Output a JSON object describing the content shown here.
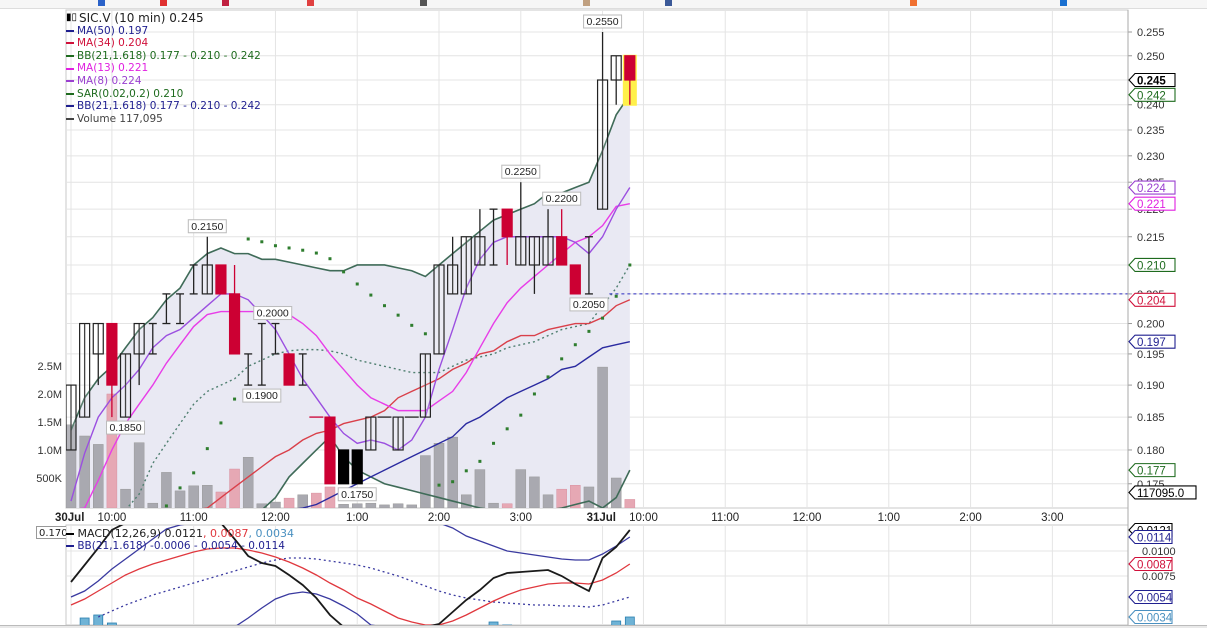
{
  "legend": {
    "title": "SIC.V (10 min) 0.245",
    "items": [
      {
        "label": "MA(50) 0.197",
        "color": "#1f1f8f"
      },
      {
        "label": "MA(34) 0.204",
        "color": "#d0103a"
      },
      {
        "label": "BB(21,1.618) 0.177 - 0.210 - 0.242",
        "color": "#1e6b1e"
      },
      {
        "label": "MA(13) 0.221",
        "color": "#e020e0"
      },
      {
        "label": "MA(8) 0.224",
        "color": "#9a40d0"
      },
      {
        "label": "SAR(0.02,0.2) 0.210",
        "color": "#1e6b1e"
      },
      {
        "label": "BB(21,1.618) 0.177 - 0.210 - 0.242",
        "color": "#1f1f8f"
      },
      {
        "label": "Volume 117,095",
        "color": "#444444"
      }
    ]
  },
  "macd_legend": {
    "name": "MACD(12,26,9)",
    "macd": "0.0121",
    "signal": ", 0.0087",
    "hist": ", 0.0034",
    "bb": "BB(21,1.618) -0.0006 - 0.0054 - 0.0114"
  },
  "cut_label": "0.170",
  "chart_data": {
    "type": "candlestick",
    "title": "SIC.V (10 min)",
    "y_scale": "log",
    "ylim": [
      0.1715,
      0.258
    ],
    "grid": true,
    "y_ticks": [
      "0.255",
      "0.250",
      "0.245",
      "0.240",
      "0.235",
      "0.230",
      "0.225",
      "0.220",
      "0.215",
      "0.210",
      "0.205",
      "0.200",
      "0.195",
      "0.190",
      "0.185",
      "0.180",
      "0.175"
    ],
    "volume_ticks": [
      {
        "label": "2.5M",
        "value": 2.5
      },
      {
        "label": "2.0M",
        "value": 2.0
      },
      {
        "label": "1.5M",
        "value": 1.5
      },
      {
        "label": "1.0M",
        "value": 1.0
      },
      {
        "label": "500K",
        "value": 0.5
      }
    ],
    "x_ticks": [
      {
        "label": "30Jul",
        "bar": 0,
        "bold": true
      },
      {
        "label": "10:00",
        "bar": 3
      },
      {
        "label": "11:00",
        "bar": 9
      },
      {
        "label": "12:00",
        "bar": 15
      },
      {
        "label": "1:00",
        "bar": 21
      },
      {
        "label": "2:00",
        "bar": 27
      },
      {
        "label": "3:00",
        "bar": 33
      },
      {
        "label": "31Jul",
        "bar": 39,
        "bold": true
      },
      {
        "label": "10:00",
        "bar": 42
      },
      {
        "label": "11:00",
        "bar": 48
      },
      {
        "label": "12:00",
        "bar": 54
      },
      {
        "label": "1:00",
        "bar": 60
      },
      {
        "label": "2:00",
        "bar": 66
      },
      {
        "label": "3:00",
        "bar": 72
      }
    ],
    "candles": [
      [
        0.18,
        0.19,
        0.18,
        0.19,
        "up"
      ],
      [
        0.185,
        0.2,
        0.185,
        0.2,
        "up"
      ],
      [
        0.195,
        0.2,
        0.19,
        0.2,
        "up"
      ],
      [
        0.2,
        0.2,
        0.185,
        0.19,
        "down"
      ],
      [
        0.185,
        0.195,
        0.185,
        0.195,
        "up"
      ],
      [
        0.195,
        0.2,
        0.19,
        0.2,
        "up"
      ],
      [
        0.2,
        0.2,
        0.195,
        0.2,
        "up"
      ],
      [
        0.205,
        0.205,
        0.2,
        0.205,
        "up"
      ],
      [
        0.205,
        0.205,
        0.2,
        0.205,
        "up"
      ],
      [
        0.21,
        0.21,
        0.205,
        0.21,
        "up"
      ],
      [
        0.205,
        0.215,
        0.205,
        0.21,
        "up"
      ],
      [
        0.21,
        0.21,
        0.205,
        0.205,
        "down"
      ],
      [
        0.205,
        0.21,
        0.195,
        0.195,
        "down"
      ],
      [
        0.195,
        0.195,
        0.19,
        0.195,
        "up"
      ],
      [
        0.2,
        0.2,
        0.19,
        0.2,
        "up"
      ],
      [
        0.2,
        0.2,
        0.195,
        0.2,
        "up"
      ],
      [
        0.195,
        0.195,
        0.19,
        0.19,
        "down"
      ],
      [
        0.195,
        0.195,
        0.19,
        0.195,
        "up"
      ],
      [
        0.185,
        0.185,
        0.185,
        0.185,
        "down"
      ],
      [
        0.185,
        0.185,
        0.175,
        0.175,
        "down"
      ],
      [
        0.18,
        0.18,
        0.175,
        0.175,
        "black"
      ],
      [
        0.18,
        0.18,
        0.175,
        0.175,
        "black"
      ],
      [
        0.18,
        0.185,
        0.18,
        0.185,
        "up"
      ],
      [
        0.185,
        0.185,
        0.185,
        0.185,
        "up"
      ],
      [
        0.18,
        0.185,
        0.18,
        0.185,
        "up"
      ],
      [
        0.185,
        0.185,
        0.185,
        0.185,
        "up"
      ],
      [
        0.185,
        0.195,
        0.185,
        0.195,
        "up"
      ],
      [
        0.195,
        0.21,
        0.195,
        0.21,
        "up"
      ],
      [
        0.205,
        0.215,
        0.205,
        0.21,
        "up"
      ],
      [
        0.205,
        0.215,
        0.205,
        0.215,
        "up"
      ],
      [
        0.21,
        0.22,
        0.21,
        0.215,
        "up"
      ],
      [
        0.22,
        0.22,
        0.21,
        0.22,
        "up"
      ],
      [
        0.22,
        0.22,
        0.21,
        0.215,
        "down"
      ],
      [
        0.21,
        0.225,
        0.21,
        0.215,
        "up"
      ],
      [
        0.21,
        0.215,
        0.205,
        0.215,
        "up"
      ],
      [
        0.21,
        0.22,
        0.21,
        0.215,
        "up"
      ],
      [
        0.215,
        0.22,
        0.21,
        0.21,
        "down"
      ],
      [
        0.21,
        0.21,
        0.205,
        0.205,
        "down"
      ],
      [
        0.205,
        0.215,
        0.205,
        0.205,
        "up"
      ],
      [
        0.22,
        0.255,
        0.22,
        0.245,
        "up"
      ],
      [
        0.245,
        0.25,
        0.24,
        0.25,
        "up"
      ],
      [
        0.25,
        0.25,
        0.24,
        0.245,
        "down"
      ]
    ],
    "highlight_last": true,
    "volume_millions": [
      1.45,
      1.25,
      1.1,
      2.0,
      0.3,
      1.13,
      0.05,
      0.6,
      0.27,
      0.36,
      0.37,
      0.25,
      0.66,
      0.87,
      0.04,
      0.07,
      0.14,
      0.2,
      0.23,
      0.34,
      0.03,
      0.04,
      0.05,
      0.02,
      0.04,
      0.02,
      0.9,
      1.12,
      1.23,
      0.2,
      0.65,
      0.05,
      0.04,
      0.65,
      0.52,
      0.2,
      0.3,
      0.37,
      0.34,
      2.48,
      0.5,
      0.117
    ],
    "series": {
      "bb_upper": [
        0.183,
        0.188,
        0.191,
        0.193,
        0.196,
        0.199,
        0.201,
        0.204,
        0.206,
        0.21,
        0.212,
        0.213,
        0.212,
        0.212,
        0.211,
        0.211,
        0.2105,
        0.21,
        0.2095,
        0.209,
        0.209,
        0.21,
        0.21,
        0.21,
        0.2095,
        0.209,
        0.208,
        0.21,
        0.212,
        0.214,
        0.216,
        0.218,
        0.219,
        0.22,
        0.221,
        0.223,
        0.223,
        0.224,
        0.225,
        0.231,
        0.238,
        0.242
      ],
      "bb_lower": [
        0.15,
        0.15,
        0.15,
        0.15,
        0.15,
        0.148,
        0.155,
        0.158,
        0.162,
        0.164,
        0.166,
        0.167,
        0.168,
        0.169,
        0.171,
        0.173,
        0.176,
        0.178,
        0.18,
        0.182,
        0.179,
        0.177,
        0.176,
        0.175,
        0.1745,
        0.174,
        0.1735,
        0.173,
        0.1725,
        0.172,
        0.1715,
        0.171,
        0.171,
        0.171,
        0.171,
        0.171,
        0.1715,
        0.172,
        0.1725,
        0.1715,
        0.173,
        0.177
      ],
      "bb_mid": [
        null,
        null,
        null,
        null,
        0.17,
        0.1735,
        0.178,
        0.181,
        0.184,
        0.187,
        0.189,
        0.19,
        0.191,
        0.193,
        0.194,
        0.195,
        0.1955,
        0.1957,
        0.1957,
        0.1955,
        0.195,
        0.194,
        0.1935,
        0.193,
        0.1925,
        0.192,
        0.192,
        0.192,
        0.193,
        0.194,
        0.1945,
        0.195,
        0.196,
        0.1965,
        0.197,
        0.198,
        0.199,
        0.1995,
        0.2,
        0.203,
        0.206,
        0.21
      ],
      "ma8": [
        0.1725,
        0.1795,
        0.185,
        0.188,
        0.19,
        0.1925,
        0.196,
        0.198,
        0.199,
        0.201,
        0.203,
        0.205,
        0.205,
        0.204,
        0.2015,
        0.199,
        0.195,
        0.191,
        0.188,
        0.185,
        0.1825,
        0.181,
        0.1815,
        0.181,
        0.18,
        0.1815,
        0.185,
        0.1925,
        0.199,
        0.206,
        0.211,
        0.214,
        0.215,
        0.215,
        0.215,
        0.215,
        0.215,
        0.214,
        0.212,
        0.215,
        0.22,
        0.224
      ],
      "ma13": [
        0.168,
        0.1715,
        0.1755,
        0.18,
        0.184,
        0.187,
        0.19,
        0.1935,
        0.1965,
        0.1995,
        0.2015,
        0.202,
        0.202,
        0.202,
        0.202,
        0.202,
        0.2015,
        0.2,
        0.198,
        0.195,
        0.1925,
        0.19,
        0.188,
        0.187,
        0.186,
        0.186,
        0.186,
        0.1875,
        0.189,
        0.192,
        0.196,
        0.2,
        0.2035,
        0.206,
        0.208,
        0.21,
        0.212,
        0.214,
        0.215,
        0.217,
        0.2205,
        0.221
      ],
      "ma34": [
        null,
        null,
        null,
        null,
        null,
        null,
        null,
        null,
        null,
        0.17,
        0.1715,
        0.173,
        0.1745,
        0.176,
        0.1775,
        0.179,
        0.18,
        0.1815,
        0.1825,
        0.183,
        0.184,
        0.1845,
        0.185,
        0.186,
        0.188,
        0.189,
        0.19,
        0.191,
        0.1925,
        0.1935,
        0.195,
        0.1955,
        0.197,
        0.198,
        0.198,
        0.199,
        0.1995,
        0.2,
        0.2,
        0.201,
        0.203,
        0.204
      ],
      "ma50": [
        null,
        null,
        null,
        null,
        null,
        null,
        null,
        null,
        null,
        null,
        null,
        null,
        null,
        null,
        null,
        null,
        0.17,
        0.1715,
        0.172,
        0.173,
        0.174,
        0.175,
        0.176,
        0.177,
        0.178,
        0.179,
        0.18,
        0.181,
        0.182,
        0.184,
        0.185,
        0.1865,
        0.188,
        0.189,
        0.19,
        0.191,
        0.1925,
        0.193,
        0.1945,
        0.196,
        0.1965,
        0.197
      ],
      "sar": [
        null,
        null,
        null,
        null,
        null,
        null,
        null,
        0.1718,
        0.1744,
        0.1766,
        0.1802,
        0.1841,
        0.1878,
        0.2146,
        0.2141,
        0.2134,
        0.213,
        0.2126,
        0.2121,
        0.2111,
        0.2088,
        0.2067,
        0.2048,
        0.203,
        0.2014,
        0.1997,
        0.1983,
        0.1748,
        0.1753,
        0.1769,
        0.1783,
        0.181,
        0.1832,
        0.1853,
        0.1886,
        0.1913,
        0.1942,
        0.1965,
        0.1987,
        0.2009,
        0.2046,
        0.21
      ]
    },
    "reference_line": {
      "value": 0.205,
      "from_bar": 39.5
    },
    "annotations": [
      {
        "text": "0.2150",
        "bar": 10,
        "price": 0.215,
        "pos": "above"
      },
      {
        "text": "0.2000",
        "bar": 14.8,
        "price": 0.2,
        "pos": "above"
      },
      {
        "text": "0.1900",
        "bar": 14,
        "price": 0.19,
        "pos": "below"
      },
      {
        "text": "0.1850",
        "bar": 4,
        "price": 0.185,
        "pos": "below"
      },
      {
        "text": "0.1750",
        "bar": 21,
        "price": 0.175,
        "pos": "below"
      },
      {
        "text": "0.2250",
        "bar": 33,
        "price": 0.225,
        "pos": "above"
      },
      {
        "text": "0.2200",
        "bar": 36,
        "price": 0.22,
        "pos": "above"
      },
      {
        "text": "0.2050",
        "bar": 38,
        "price": 0.205,
        "pos": "below"
      },
      {
        "text": "0.2550",
        "bar": 39,
        "price": 0.255,
        "pos": "above"
      }
    ],
    "price_markers": [
      {
        "text": "0.245",
        "value": 0.245,
        "color": "#000000",
        "bold": true
      },
      {
        "text": "0.242",
        "value": 0.242,
        "color": "#1e6b1e"
      },
      {
        "text": "0.224",
        "value": 0.224,
        "color": "#9a40d0"
      },
      {
        "text": "0.221",
        "value": 0.221,
        "color": "#e020e0"
      },
      {
        "text": "0.210",
        "value": 0.21,
        "color": "#1e6b1e"
      },
      {
        "text": "0.204",
        "value": 0.204,
        "color": "#d0103a"
      },
      {
        "text": "0.197",
        "value": 0.197,
        "color": "#1f1f8f"
      },
      {
        "text": "0.177",
        "value": 0.177,
        "color": "#1e6b1e"
      }
    ],
    "volume_marker": {
      "text": "117095.0",
      "value": 0.117095,
      "color": "#000000"
    },
    "macd": {
      "y_ticks": [
        "0.0100",
        "0.0075"
      ],
      "macd": [
        0.0069,
        0.0086,
        0.0103,
        0.0121,
        0.0135,
        0.0145,
        0.0152,
        0.0156,
        0.0158,
        0.0158,
        0.0155,
        0.013,
        0.0112,
        0.0095,
        0.0088,
        0.0085,
        0.0076,
        0.0066,
        0.0053,
        0.0036,
        0.0016,
        0.0001,
        0.0,
        -0.0005,
        -0.0008,
        -0.0005,
        0.0016,
        0.0027,
        0.0039,
        0.0051,
        0.0061,
        0.0073,
        0.0078,
        0.0079,
        0.008,
        0.0081,
        0.0075,
        0.0067,
        0.006,
        0.0093,
        0.0104,
        0.0121
      ],
      "signal": [
        0.0046,
        0.0052,
        0.006,
        0.0068,
        0.0076,
        0.0082,
        0.0087,
        0.0091,
        0.0095,
        0.0099,
        0.0102,
        0.0103,
        0.0103,
        0.0101,
        0.0098,
        0.0094,
        0.0089,
        0.0083,
        0.0076,
        0.0068,
        0.0061,
        0.0053,
        0.0047,
        0.004,
        0.0033,
        0.0029,
        0.0026,
        0.0026,
        0.003,
        0.0036,
        0.0043,
        0.005,
        0.0056,
        0.0061,
        0.0064,
        0.0067,
        0.0068,
        0.0068,
        0.0067,
        0.0071,
        0.0078,
        0.0087
      ],
      "bb_upper": [
        0.0054,
        0.006,
        0.007,
        0.0082,
        0.0092,
        0.0102,
        0.0112,
        0.0122,
        0.0126,
        0.0129,
        0.0131,
        0.0133,
        0.0135,
        0.0137,
        0.0138,
        0.0139,
        0.014,
        0.014,
        0.014,
        0.014,
        0.0139,
        0.0138,
        0.0137,
        0.0136,
        0.0135,
        0.0133,
        0.0131,
        0.0128,
        0.0123,
        0.0115,
        0.011,
        0.0105,
        0.01,
        0.0098,
        0.0096,
        0.0094,
        0.0092,
        0.0091,
        0.0091,
        0.0097,
        0.0105,
        0.0114
      ],
      "bb_lower": [
        -0.004,
        -0.003,
        -0.002,
        -0.001,
        -0.0005,
        0.0,
        0.0003,
        0.0005,
        0.0007,
        0.0009,
        0.0011,
        0.0013,
        0.002,
        0.0033,
        0.0043,
        0.0052,
        0.0057,
        0.0059,
        0.0057,
        0.0052,
        0.0045,
        0.0037,
        0.0026,
        0.0018,
        0.001,
        0.0005,
        0.0002,
        0.0,
        -0.0002,
        -0.0003,
        -0.0004,
        -0.0005,
        -0.0005,
        -0.0006,
        -0.0006,
        -0.0006,
        -0.0006,
        -0.0006,
        -0.0006,
        -0.0006,
        -0.0006,
        -0.0006
      ],
      "bb_mid": [
        null,
        null,
        0.0034,
        0.004,
        0.0046,
        0.0051,
        0.0056,
        0.006,
        0.0064,
        0.0068,
        0.0072,
        0.0076,
        0.008,
        0.0084,
        0.0088,
        0.0091,
        0.0093,
        0.0093,
        0.0092,
        0.009,
        0.0088,
        0.0086,
        0.0083,
        0.0079,
        0.0075,
        0.007,
        0.0065,
        0.006,
        0.0056,
        0.0053,
        0.0051,
        0.0049,
        0.0048,
        0.0047,
        0.0046,
        0.0046,
        0.0045,
        0.0045,
        0.0044,
        0.0046,
        0.005,
        0.0054
      ],
      "histogram": [
        null,
        0.0033,
        0.0036,
        0.0028,
        null,
        null,
        null,
        null,
        null,
        null,
        null,
        null,
        null,
        null,
        null,
        null,
        null,
        null,
        null,
        null,
        null,
        null,
        null,
        null,
        null,
        null,
        null,
        null,
        null,
        null,
        null,
        0.0029,
        0.0026,
        null,
        null,
        null,
        null,
        null,
        null,
        null,
        0.003,
        0.0034
      ],
      "markers": [
        {
          "text": "0.0121",
          "value": 0.0121,
          "color": "#000000"
        },
        {
          "text": "0.0114",
          "value": 0.0114,
          "color": "#1f1f8f"
        },
        {
          "text": "0.0087",
          "value": 0.0087,
          "color": "#d0103a"
        },
        {
          "text": "0.0054",
          "value": 0.0054,
          "color": "#1f1f8f"
        },
        {
          "text": "0.0034",
          "value": 0.0034,
          "color": "#4a90c0"
        }
      ]
    },
    "colors": {
      "up_candle": "#222222",
      "down_candle": "#cc0033",
      "black_candle": "#000000",
      "volume_up": "#a9a9b0",
      "volume_down": "#e6a8b4",
      "bb_band": "#3f6b58",
      "bb_fill": "#e9e9f3",
      "bb_mid": "#4f7f70",
      "ma8": "#9b4fe0",
      "ma13": "#e83de8",
      "ma34": "#d9404a",
      "ma50": "#2a2aa0",
      "sar": "#2e7d2e",
      "highlight": "#fff04a",
      "reference": "#2a2ac0",
      "macd": "#1a1a1a",
      "signal": "#e0383e",
      "macd_bb": "#3a3aa0",
      "histogram": "#6fb3d6"
    }
  }
}
